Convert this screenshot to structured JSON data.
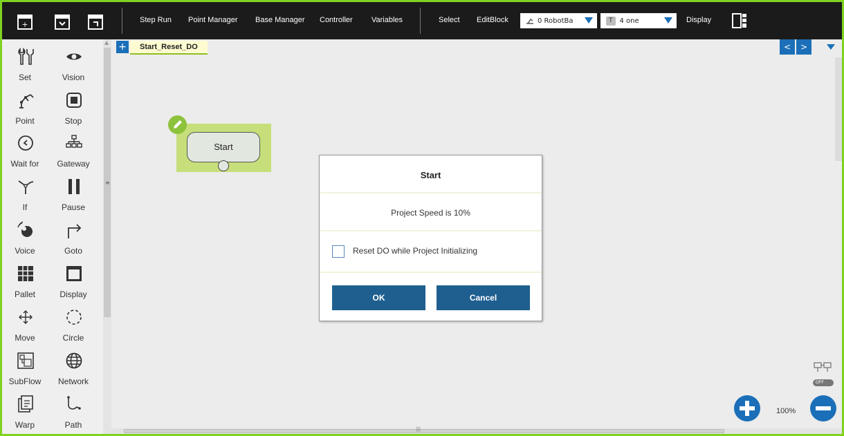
{
  "toolbar": {
    "file_icons": [
      "new-file-icon",
      "open-file-icon",
      "save-file-icon"
    ],
    "menu": [
      "Step Run",
      "Point Manager",
      "Base Manager",
      "Controller",
      "Variables"
    ],
    "select_label": "Select",
    "editblock_label": "EditBlock",
    "base_select": {
      "icon": "robot-base-icon",
      "value": "0 RobotBa"
    },
    "tool_select": {
      "badge": "T",
      "value": "4 one"
    },
    "display_label": "Display",
    "layout_icon": "panel-layout-icon"
  },
  "palette": {
    "items": [
      {
        "label": "Set",
        "icon": "wrench-icon"
      },
      {
        "label": "Vision",
        "icon": "eye-icon"
      },
      {
        "label": "Point",
        "icon": "robot-arm-icon"
      },
      {
        "label": "Stop",
        "icon": "stop-icon"
      },
      {
        "label": "Wait for",
        "icon": "clock-icon"
      },
      {
        "label": "Gateway",
        "icon": "hierarchy-icon"
      },
      {
        "label": "If",
        "icon": "branch-icon"
      },
      {
        "label": "Pause",
        "icon": "pause-icon"
      },
      {
        "label": "Voice",
        "icon": "voice-icon"
      },
      {
        "label": "Goto",
        "icon": "goto-arrow-icon"
      },
      {
        "label": "Pallet",
        "icon": "grid-icon"
      },
      {
        "label": "Display",
        "icon": "display-icon"
      },
      {
        "label": "Move",
        "icon": "move-arrows-icon"
      },
      {
        "label": "Circle",
        "icon": "dashed-circle-icon"
      },
      {
        "label": "SubFlow",
        "icon": "subflow-icon"
      },
      {
        "label": "Network",
        "icon": "globe-icon"
      },
      {
        "label": "Warp",
        "icon": "warp-icon"
      },
      {
        "label": "Path",
        "icon": "path-icon"
      }
    ]
  },
  "canvas": {
    "tab_add": "+",
    "tab_label": "Start_Reset_DO",
    "nav_prev": "<",
    "nav_next": ">",
    "start_node_label": "Start",
    "zoom_level": "100%",
    "toggle_state": "OFF"
  },
  "dialog": {
    "title": "Start",
    "message": "Project Speed is 10%",
    "checkbox_label": "Reset DO while Project Initializing",
    "checkbox_checked": false,
    "ok_label": "OK",
    "cancel_label": "Cancel"
  },
  "colors": {
    "border_green": "#7ed321",
    "toolbar_bg": "#1b1b1b",
    "accent_blue": "#1b6fb8",
    "button_blue": "#1e5f8f",
    "node_green": "#c6df7a"
  }
}
